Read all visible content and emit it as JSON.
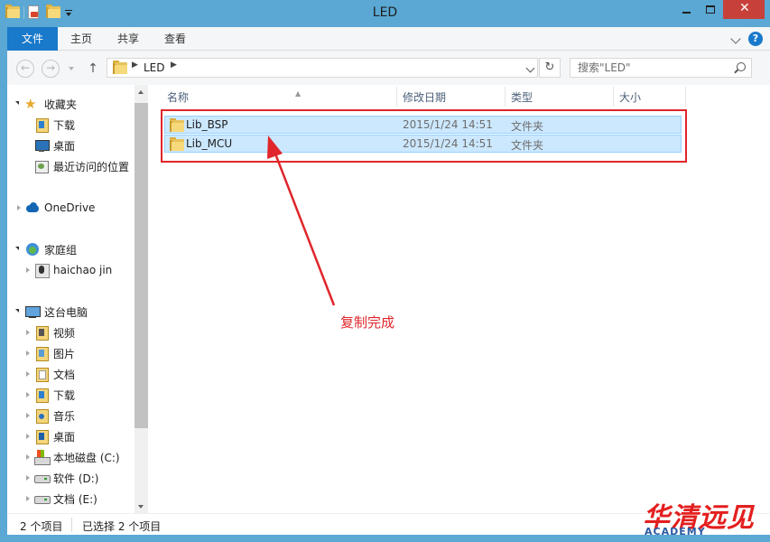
{
  "window": {
    "title": "LED"
  },
  "ribbon": {
    "tabs": [
      "文件",
      "主页",
      "共享",
      "查看"
    ],
    "help": "?"
  },
  "address": {
    "path": "LED",
    "search_placeholder": "搜索\"LED\""
  },
  "sidebar": {
    "favorites": {
      "label": "收藏夹",
      "items": [
        "下载",
        "桌面",
        "最近访问的位置"
      ]
    },
    "onedrive": "OneDrive",
    "homegroup": {
      "label": "家庭组",
      "items": [
        "haichao jin"
      ]
    },
    "this_pc": {
      "label": "这台电脑",
      "items": [
        "视频",
        "图片",
        "文档",
        "下载",
        "音乐",
        "桌面",
        "本地磁盘 (C:)",
        "软件 (D:)",
        "文档 (E:)"
      ]
    }
  },
  "columns": [
    "名称",
    "修改日期",
    "类型",
    "大小"
  ],
  "files": [
    {
      "name": "Lib_BSP",
      "date": "2015/1/24 14:51",
      "type": "文件夹"
    },
    {
      "name": "Lib_MCU",
      "date": "2015/1/24 14:51",
      "type": "文件夹"
    }
  ],
  "annotation": "复制完成",
  "status": {
    "count": "2 个项目",
    "selected": "已选择 2 个项目"
  },
  "watermark": {
    "main": "华清远见",
    "sub": "ACADEMY"
  },
  "colors": {
    "titlebar": "#5aa8d3",
    "file_tab": "#1979ca",
    "selection": "#cce8ff",
    "annotation": "#e0262b"
  }
}
